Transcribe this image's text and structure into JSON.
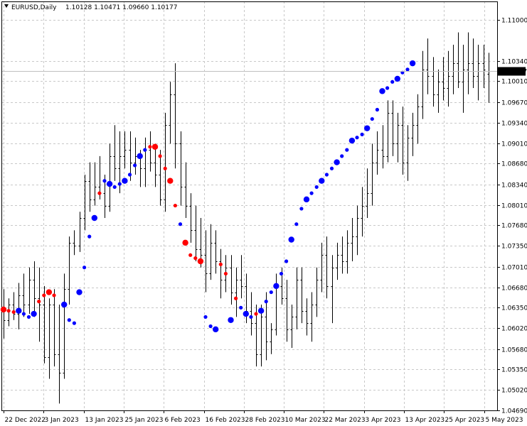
{
  "header": {
    "symbol": "EURUSD,Daily",
    "ohlc": "1.10128 1.10471 1.09660 1.10177"
  },
  "current_price": "1.10177",
  "colors": {
    "background": "#ffffff",
    "grid": "#c8c8c8",
    "bars": "#000000",
    "dot_up": "#0000ff",
    "dot_down": "#ff0000",
    "price_label_bg": "#000000",
    "price_label_text": "#ffffff"
  },
  "chart_data": {
    "type": "scatter",
    "title": "",
    "xlabel": "",
    "ylabel": "",
    "ylim": [
      1.0469,
      1.113
    ],
    "grid": true,
    "y_ticks": [
      "1.11000",
      "1.10340",
      "1.10010",
      "1.09670",
      "1.09340",
      "1.09010",
      "1.08680",
      "1.08340",
      "1.08010",
      "1.07680",
      "1.07350",
      "1.07010",
      "1.06680",
      "1.06350",
      "1.06020",
      "1.05680",
      "1.05350",
      "1.05020",
      "1.04690"
    ],
    "x_ticks": [
      "22 Dec 2022",
      "3 Jan 2023",
      "13 Jan 2023",
      "25 Jan 2023",
      "6 Feb 2023",
      "16 Feb 2023",
      "28 Feb 2023",
      "10 Mar 2023",
      "22 Mar 2023",
      "3 Apr 2023",
      "13 Apr 2023",
      "25 Apr 2023",
      "5 May 2023"
    ],
    "ohlc_bars": [
      [
        1.063,
        1.0665,
        1.0585,
        1.0615
      ],
      [
        1.0615,
        1.065,
        1.0605,
        1.064
      ],
      [
        1.064,
        1.066,
        1.0615,
        1.0625
      ],
      [
        1.0625,
        1.0675,
        1.06,
        1.0655
      ],
      [
        1.0655,
        1.069,
        1.062,
        1.064
      ],
      [
        1.064,
        1.07,
        1.0625,
        1.068
      ],
      [
        1.068,
        1.071,
        1.062,
        1.065
      ],
      [
        1.065,
        1.07,
        1.058,
        1.064
      ],
      [
        1.064,
        1.067,
        1.0545,
        1.0555
      ],
      [
        1.0555,
        1.065,
        1.052,
        1.064
      ],
      [
        1.064,
        1.0665,
        1.054,
        1.056
      ],
      [
        1.056,
        1.064,
        1.048,
        1.053
      ],
      [
        1.053,
        1.069,
        1.052,
        1.0665
      ],
      [
        1.0665,
        1.075,
        1.064,
        1.074
      ],
      [
        1.074,
        1.076,
        1.072,
        1.0735
      ],
      [
        1.0735,
        1.079,
        1.0725,
        1.078
      ],
      [
        1.078,
        1.085,
        1.076,
        1.084
      ],
      [
        1.084,
        1.087,
        1.079,
        1.081
      ],
      [
        1.081,
        1.087,
        1.08,
        1.083
      ],
      [
        1.083,
        1.088,
        1.081,
        1.082
      ],
      [
        1.082,
        1.085,
        1.078,
        1.08
      ],
      [
        1.08,
        1.09,
        1.079,
        1.088
      ],
      [
        1.088,
        1.093,
        1.084,
        1.086
      ],
      [
        1.086,
        1.092,
        1.082,
        1.088
      ],
      [
        1.088,
        1.092,
        1.086,
        1.089
      ],
      [
        1.089,
        1.092,
        1.084,
        1.087
      ],
      [
        1.087,
        1.091,
        1.085,
        1.088
      ],
      [
        1.088,
        1.089,
        1.083,
        1.086
      ],
      [
        1.086,
        1.091,
        1.083,
        1.089
      ],
      [
        1.089,
        1.092,
        1.0855,
        1.087
      ],
      [
        1.087,
        1.09,
        1.083,
        1.085
      ],
      [
        1.085,
        1.089,
        1.08,
        1.081
      ],
      [
        1.081,
        1.095,
        1.079,
        1.093
      ],
      [
        1.093,
        1.1,
        1.09,
        1.098
      ],
      [
        1.098,
        1.103,
        1.086,
        1.09
      ],
      [
        1.09,
        1.092,
        1.08,
        1.083
      ],
      [
        1.083,
        1.087,
        1.078,
        1.08
      ],
      [
        1.08,
        1.082,
        1.074,
        1.076
      ],
      [
        1.076,
        1.08,
        1.071,
        1.073
      ],
      [
        1.073,
        1.078,
        1.07,
        1.072
      ],
      [
        1.072,
        1.076,
        1.066,
        1.069
      ],
      [
        1.069,
        1.077,
        1.068,
        1.074
      ],
      [
        1.074,
        1.076,
        1.069,
        1.071
      ],
      [
        1.071,
        1.073,
        1.065,
        1.068
      ],
      [
        1.068,
        1.072,
        1.066,
        1.07
      ],
      [
        1.07,
        1.072,
        1.064,
        1.066
      ],
      [
        1.066,
        1.07,
        1.062,
        1.068
      ],
      [
        1.068,
        1.072,
        1.065,
        1.067
      ],
      [
        1.067,
        1.069,
        1.061,
        1.063
      ],
      [
        1.063,
        1.066,
        1.059,
        1.061
      ],
      [
        1.061,
        1.064,
        1.054,
        1.056
      ],
      [
        1.056,
        1.064,
        1.054,
        1.062
      ],
      [
        1.062,
        1.066,
        1.055,
        1.058
      ],
      [
        1.058,
        1.061,
        1.056,
        1.06
      ],
      [
        1.06,
        1.069,
        1.059,
        1.067
      ],
      [
        1.067,
        1.07,
        1.064,
        1.065
      ],
      [
        1.065,
        1.068,
        1.058,
        1.06
      ],
      [
        1.06,
        1.064,
        1.057,
        1.062
      ],
      [
        1.062,
        1.07,
        1.06,
        1.068
      ],
      [
        1.068,
        1.07,
        1.061,
        1.063
      ],
      [
        1.063,
        1.065,
        1.059,
        1.061
      ],
      [
        1.061,
        1.066,
        1.058,
        1.064
      ],
      [
        1.064,
        1.07,
        1.062,
        1.068
      ],
      [
        1.068,
        1.074,
        1.066,
        1.072
      ],
      [
        1.072,
        1.075,
        1.065,
        1.067
      ],
      [
        1.067,
        1.072,
        1.061,
        1.07
      ],
      [
        1.07,
        1.074,
        1.068,
        1.072
      ],
      [
        1.072,
        1.075,
        1.069,
        1.071
      ],
      [
        1.071,
        1.076,
        1.069,
        1.074
      ],
      [
        1.074,
        1.078,
        1.071,
        1.075
      ],
      [
        1.075,
        1.08,
        1.072,
        1.078
      ],
      [
        1.078,
        1.083,
        1.075,
        1.08
      ],
      [
        1.08,
        1.086,
        1.078,
        1.082
      ],
      [
        1.082,
        1.09,
        1.08,
        1.087
      ],
      [
        1.087,
        1.092,
        1.085,
        1.089
      ],
      [
        1.089,
        1.093,
        1.086,
        1.088
      ],
      [
        1.088,
        1.097,
        1.087,
        1.095
      ],
      [
        1.095,
        1.097,
        1.088,
        1.09
      ],
      [
        1.09,
        1.095,
        1.087,
        1.093
      ],
      [
        1.093,
        1.096,
        1.085,
        1.087
      ],
      [
        1.087,
        1.093,
        1.084,
        1.091
      ],
      [
        1.091,
        1.095,
        1.088,
        1.093
      ],
      [
        1.093,
        1.098,
        1.09,
        1.096
      ],
      [
        1.096,
        1.105,
        1.094,
        1.102
      ],
      [
        1.102,
        1.107,
        1.098,
        1.101
      ],
      [
        1.101,
        1.104,
        1.096,
        1.098
      ],
      [
        1.098,
        1.102,
        1.095,
        1.1
      ],
      [
        1.1,
        1.104,
        1.097,
        1.099
      ],
      [
        1.099,
        1.105,
        1.096,
        1.101
      ],
      [
        1.101,
        1.106,
        1.098,
        1.103
      ],
      [
        1.103,
        1.108,
        1.099,
        1.1
      ],
      [
        1.1,
        1.106,
        1.095,
        1.102
      ],
      [
        1.102,
        1.108,
        1.098,
        1.103
      ],
      [
        1.103,
        1.107,
        1.099,
        1.101
      ],
      [
        1.101,
        1.106,
        1.097,
        1.103
      ],
      [
        1.103,
        1.106,
        1.099,
        1.102
      ],
      [
        1.1013,
        1.1047,
        1.0966,
        1.1018
      ]
    ],
    "series": [
      {
        "color": "#0000ff",
        "points": [
          [
            3,
            1.063
          ],
          [
            4,
            1.0625
          ],
          [
            5,
            1.062
          ],
          [
            6,
            1.0625
          ],
          [
            12,
            1.064
          ],
          [
            13,
            1.0615
          ],
          [
            14,
            1.061
          ],
          [
            15,
            1.066
          ],
          [
            16,
            1.07
          ],
          [
            17,
            1.075
          ],
          [
            18,
            1.078
          ],
          [
            20,
            1.084
          ],
          [
            21,
            1.0835
          ],
          [
            22,
            1.083
          ],
          [
            23,
            1.0835
          ],
          [
            24,
            1.084
          ],
          [
            25,
            1.085
          ],
          [
            26,
            1.0865
          ],
          [
            27,
            1.088
          ],
          [
            28,
            1.089
          ],
          [
            35,
            1.077
          ],
          [
            40,
            1.062
          ],
          [
            41,
            1.0605
          ],
          [
            42,
            1.06
          ],
          [
            45,
            1.0615
          ],
          [
            47,
            1.0635
          ],
          [
            48,
            1.0625
          ],
          [
            49,
            1.062
          ],
          [
            51,
            1.063
          ],
          [
            52,
            1.0645
          ],
          [
            53,
            1.066
          ],
          [
            54,
            1.067
          ],
          [
            55,
            1.069
          ],
          [
            56,
            1.071
          ],
          [
            57,
            1.0745
          ],
          [
            58,
            1.077
          ],
          [
            59,
            1.0795
          ],
          [
            60,
            1.081
          ],
          [
            61,
            1.082
          ],
          [
            62,
            1.083
          ],
          [
            63,
            1.084
          ],
          [
            64,
            1.085
          ],
          [
            65,
            1.086
          ],
          [
            66,
            1.087
          ],
          [
            67,
            1.088
          ],
          [
            68,
            1.089
          ],
          [
            69,
            1.0905
          ],
          [
            70,
            1.091
          ],
          [
            71,
            1.0915
          ],
          [
            72,
            1.0925
          ],
          [
            73,
            1.094
          ],
          [
            74,
            1.0955
          ],
          [
            75,
            1.0985
          ],
          [
            76,
            1.099
          ],
          [
            77,
            1.1
          ],
          [
            78,
            1.1005
          ],
          [
            79,
            1.1015
          ],
          [
            80,
            1.102
          ],
          [
            81,
            1.103
          ]
        ]
      },
      {
        "color": "#ff0000",
        "points": [
          [
            0,
            1.0632
          ],
          [
            1,
            1.063
          ],
          [
            2,
            1.0628
          ],
          [
            7,
            1.0645
          ],
          [
            8,
            1.0655
          ],
          [
            9,
            1.066
          ],
          [
            10,
            1.0655
          ],
          [
            19,
            1.082
          ],
          [
            29,
            1.0895
          ],
          [
            30,
            1.0895
          ],
          [
            31,
            1.088
          ],
          [
            32,
            1.086
          ],
          [
            33,
            1.084
          ],
          [
            34,
            1.08
          ],
          [
            36,
            1.074
          ],
          [
            37,
            1.072
          ],
          [
            38,
            1.0715
          ],
          [
            39,
            1.071
          ],
          [
            43,
            1.0705
          ],
          [
            44,
            1.069
          ],
          [
            46,
            1.065
          ],
          [
            50,
            1.0625
          ]
        ]
      }
    ]
  }
}
